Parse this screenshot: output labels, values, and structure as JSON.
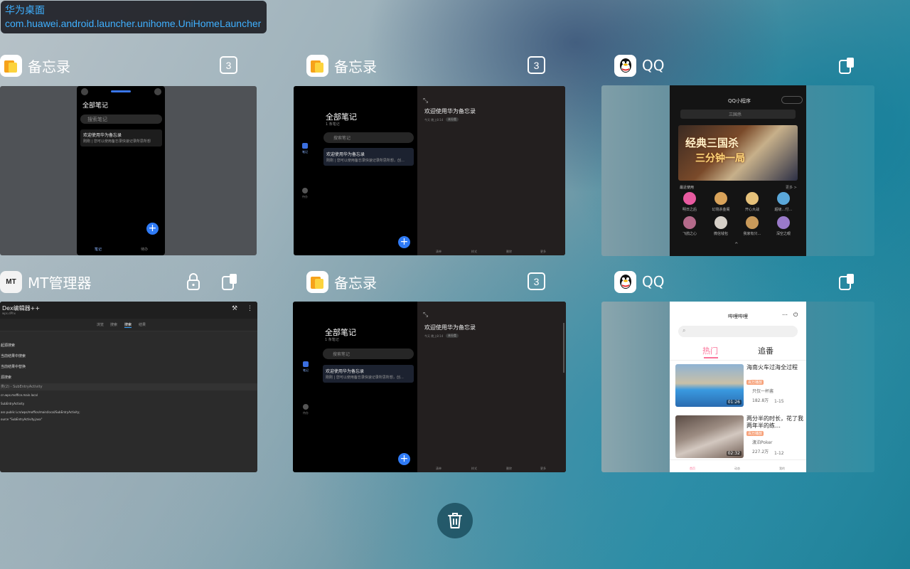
{
  "tooltip": {
    "title": "华为桌面",
    "package": "com.huawei.android.launcher.unihome.UniHomeLauncher"
  },
  "cards": {
    "memo1": {
      "name": "备忘录",
      "count": "3",
      "all_notes": "全部笔记",
      "search": "搜索笔记",
      "note_title": "欢迎使用华为备忘录",
      "note_body": "刚刚 | 您可以使用备忘录快速记录所思所想",
      "tab_notes": "笔记",
      "tab_todo": "待办"
    },
    "memo2": {
      "name": "备忘录",
      "count": "3",
      "all_notes": "全部笔记",
      "sub": "1 条笔记",
      "search": "搜索笔记",
      "note_title": "欢迎使用华为备忘录",
      "note_body": "刚刚 | 您可以使用备忘录快速记录所思所想，创…",
      "detail_title": "欢迎使用华为备忘录",
      "detail_meta": "今天 晚上8:14",
      "detail_tag": "未分类",
      "side_notes": "笔记",
      "side_todo": "待办",
      "bottom": [
        "清单",
        "样式",
        "删除",
        "更多"
      ]
    },
    "qq1": {
      "name": "QQ",
      "mini_title": "QQ小程序",
      "search": "三国杀",
      "banner_line1": "经典三国杀",
      "banner_line2": "三分钟一局",
      "recent": "最近使用",
      "more": "更多 >",
      "apps": [
        "明日之后",
        "幻境杀金阁",
        "开心大战",
        "超级…付…",
        "飞鸽之心",
        "微信钱包",
        "我家有只…",
        "深空之眼"
      ]
    },
    "mt": {
      "name": "MT管理器",
      "title": "Dex编辑器++",
      "subtitle": "wps.dPhx",
      "tabs": [
        "浏览",
        "搜索",
        "搜索",
        "结果"
      ],
      "rows": [
        "起源搜索",
        "当前结果中搜索",
        "当前结果中替换",
        "源搜索"
      ],
      "section": "类(2) - SubEntryActivity",
      "lines": [
        "cn.wps.moffice.main.local",
        "SubEntryActivity",
        "ass public Lcn/wps/moffice/main/local/SubEntryActivity;",
        "ource \"SubEntryActivity.java\""
      ]
    },
    "memo3": {
      "name": "备忘录",
      "count": "3",
      "all_notes": "全部笔记",
      "sub": "1 条笔记",
      "search": "搜索笔记",
      "note_title": "欢迎使用华为备忘录",
      "note_body": "刚刚 | 您可以使用备忘录快速记录所思所想，创…",
      "detail_title": "欢迎使用华为备忘录",
      "detail_meta": "今天 晚上8:14",
      "detail_tag": "未分类",
      "side_notes": "笔记",
      "side_todo": "待办",
      "bottom": [
        "清单",
        "样式",
        "删除",
        "更多"
      ]
    },
    "qq2": {
      "name": "QQ",
      "page_title": "哔哩哔哩",
      "tab_hot": "热门",
      "tab_follow": "追番",
      "videos": [
        {
          "title": "海南火车过海全过程",
          "tag": "百万播放",
          "author": "只仅一杯酱",
          "views": "182.8万",
          "date": "1-15",
          "duration": "01:26"
        },
        {
          "title": "两分半的时长，花了我两年半的练…",
          "tag": "百万播放",
          "author": "渡泊Poker",
          "views": "227.2万",
          "date": "1-12",
          "duration": "02:32"
        }
      ],
      "nav": [
        "首页",
        "动态",
        "我的"
      ]
    }
  },
  "colors": {
    "accent_blue": "#2f7bf6",
    "bili_pink": "#fb7299",
    "tooltip_text": "#3fb0ff"
  }
}
